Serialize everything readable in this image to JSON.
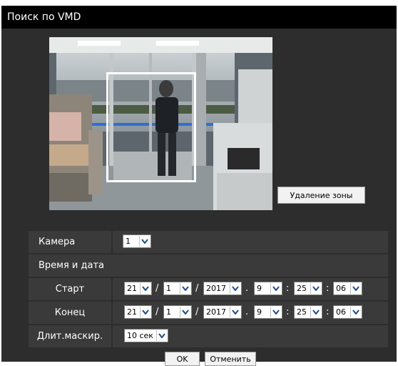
{
  "window": {
    "title": "Поиск по VMD"
  },
  "camera_view": {
    "delete_zone_label": "Удаление зоны"
  },
  "form": {
    "camera": {
      "label": "Камера",
      "value": "1"
    },
    "datetime": {
      "label": "Время и дата"
    },
    "start": {
      "label": "Старт",
      "day": "21",
      "month": "1",
      "year": "2017",
      "hour": "9",
      "minute": "25",
      "second": "06"
    },
    "end": {
      "label": "Конец",
      "day": "21",
      "month": "1",
      "year": "2017",
      "hour": "9",
      "minute": "25",
      "second": "06"
    },
    "mask_duration": {
      "label": "Длит.маскир.",
      "value": "10 сек"
    },
    "date_sep": "/",
    "dot_sep": ".",
    "time_sep": ":"
  },
  "buttons": {
    "ok": "OK",
    "cancel": "Отменить"
  },
  "colors": {
    "title_bar": "#000000",
    "panel": "#2d2d2d",
    "row": "#3a3a3a",
    "zone_border": "#ffffff",
    "dropdown_arrow": "#1a4d8c"
  }
}
